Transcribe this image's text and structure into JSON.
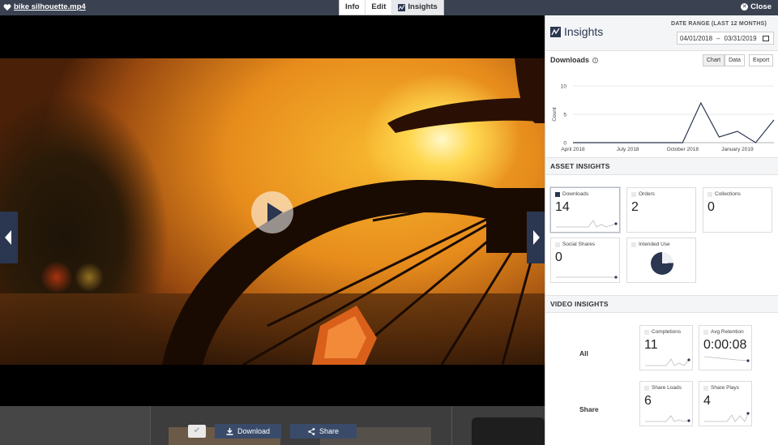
{
  "topbar": {
    "file_name": "bike silhouette.mp4",
    "tabs": [
      {
        "label": "Info",
        "active": false
      },
      {
        "label": "Edit",
        "active": false
      },
      {
        "label": "Insights",
        "active": true
      }
    ],
    "close_label": "Close"
  },
  "strip": {
    "download_label": "Download",
    "share_label": "Share"
  },
  "insights": {
    "title": "Insights",
    "date_range_label": "DATE RANGE (LAST 12 MONTHS)",
    "date_from": "04/01/2018",
    "date_sep": "–",
    "date_to": "03/31/2019",
    "downloads_title": "Downloads",
    "chart_button": "Chart",
    "data_button": "Data",
    "export_button": "Export",
    "asset_section": "ASSET INSIGHTS",
    "video_section": "VIDEO INSIGHTS",
    "asset_cards": [
      {
        "label": "Downloads",
        "value": "14"
      },
      {
        "label": "Orders",
        "value": "2"
      },
      {
        "label": "Collections",
        "value": "0"
      },
      {
        "label": "Social Shares",
        "value": "0"
      },
      {
        "label": "Intended Use",
        "value": ""
      }
    ],
    "intended_use_share": 0.76,
    "video_rows": [
      {
        "label": "All",
        "cards": [
          {
            "label": "Completions",
            "value": "11"
          },
          {
            "label": "Avg Retention",
            "value": "0:00:08"
          }
        ]
      },
      {
        "label": "Share",
        "cards": [
          {
            "label": "Share Loads",
            "value": "6"
          },
          {
            "label": "Share Plays",
            "value": "4"
          }
        ]
      }
    ]
  },
  "accent_color": "#2b3650",
  "chart_data": {
    "type": "line",
    "x": [
      "2018-04",
      "2018-05",
      "2018-06",
      "2018-07",
      "2018-08",
      "2018-09",
      "2018-10",
      "2018-11",
      "2018-12",
      "2019-01",
      "2019-02",
      "2019-03"
    ],
    "series": [
      {
        "values": [
          0,
          0,
          0,
          0,
          0,
          0,
          0,
          7,
          1,
          2,
          0,
          4
        ]
      }
    ],
    "tick_labels_x": [
      "April 2018",
      "July 2018",
      "October 2018",
      "January 2019"
    ],
    "tick_labels_y": [
      "0",
      "5",
      "10"
    ],
    "ylabel": "Count",
    "ylim": [
      0,
      10
    ],
    "grid": true
  }
}
